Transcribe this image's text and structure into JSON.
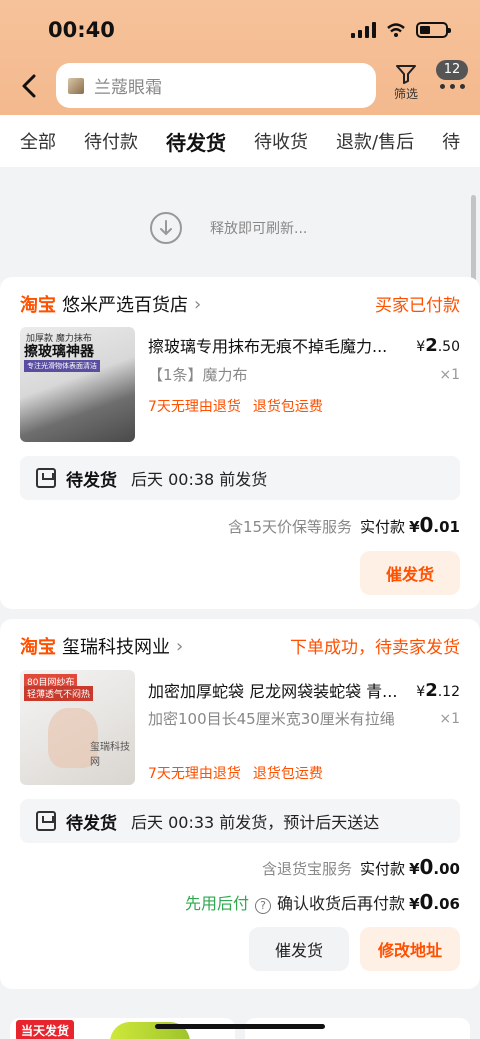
{
  "status_bar": {
    "time": "00:40"
  },
  "header": {
    "search_text": "兰蔻眼霜",
    "filter_label": "筛选",
    "badge_count": "12"
  },
  "tabs": [
    "全部",
    "待付款",
    "待发货",
    "待收货",
    "退款/售后",
    "待"
  ],
  "active_tab_index": 2,
  "refresh_text": "释放即可刷新...",
  "orders": [
    {
      "shop_brand": "淘宝",
      "shop_name": "悠米严选百货店",
      "status": "买家已付款",
      "thumb": {
        "line1": "加厚款 魔力抹布",
        "line2": "擦玻璃神器",
        "line3": "专注光滑物体表面清洁"
      },
      "title": "擦玻璃专用抹布无痕不掉毛魔力...",
      "price_symbol": "¥",
      "price_int": "2",
      "price_dec": ".50",
      "sku": "【1条】魔力布",
      "qty": "×1",
      "tags": [
        "7天无理由退货",
        "退货包运费"
      ],
      "ship_label": "待发货",
      "ship_text": "后天 00:38 前发货",
      "pay_sub": "含15天价保等服务",
      "pay_label": "实付款",
      "pay_symbol": "¥",
      "pay_int": "0",
      "pay_dec": ".01",
      "buttons": [
        "催发货"
      ]
    },
    {
      "shop_brand": "淘宝",
      "shop_name": "玺瑞科技网业",
      "status": "下单成功，待卖家发货",
      "thumb": {
        "line1": "80目网纱布",
        "line2": "轻薄透气不闷热",
        "line3": "玺瑞科技网"
      },
      "title": "加密加厚蛇袋 尼龙网袋装蛇袋 青...",
      "price_symbol": "¥",
      "price_int": "2",
      "price_dec": ".12",
      "sku": "加密100目长45厘米宽30厘米有拉绳",
      "qty": "×1",
      "tags": [
        "7天无理由退货",
        "退货包运费"
      ],
      "ship_label": "待发货",
      "ship_text": "后天 00:33 前发货，预计后天送达",
      "pay_sub": "含退货宝服务",
      "pay_label": "实付款",
      "pay_symbol": "¥",
      "pay_int": "0",
      "pay_dec": ".00",
      "later_green": "先用后付",
      "later_text": "确认收货后再付款",
      "later_symbol": "¥",
      "later_int": "0",
      "later_dec": ".06",
      "buttons": [
        "催发货",
        "修改地址"
      ]
    }
  ],
  "bottom": {
    "same_day_tag": "当天发货"
  },
  "colors": {
    "accent": "#ff5000",
    "header_bg": "#f6c29a",
    "green": "#2fa84f"
  }
}
